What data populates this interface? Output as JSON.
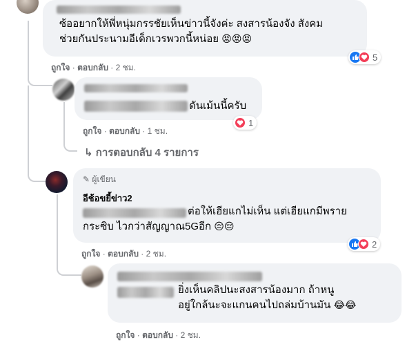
{
  "comments": [
    {
      "text_line1": "ซ้ออยากให้พี่หนุ่มกรรชัยเห็นข่าวนี้จังค่ะ สงสารน้องจัง สังคม",
      "text_line2": "ช่วยกันประนามอีเด็กเวรพวกนี้หน่อย",
      "emoji": "😡😡😡",
      "like_label": "ถูกใจ",
      "reply_label": "ตอบกลับ",
      "time": "2 ชม.",
      "reaction_count": "5"
    },
    {
      "text": "ดันเม้นนี้ครับ",
      "like_label": "ถูกใจ",
      "reply_label": "ตอบกลับ",
      "time": "1 ชม.",
      "reaction_count": "1",
      "replies_link": "การตอบกลับ 4 รายการ"
    },
    {
      "author_badge": "ผู้เขียน",
      "author_name": "อีช้อขยี้ข่าว2",
      "text_line1": "ต่อให้เฮียแกไม่เห็น แต่เฮียแกมีพราย",
      "text_line2": "กระซิบ ไวกว่าสัญญาณ5Gอีก",
      "emoji": "😔😔",
      "like_label": "ถูกใจ",
      "reply_label": "ตอบกลับ",
      "time": "2 ชม.",
      "reaction_count": "2"
    },
    {
      "text_line1": "ยิ่งเห็นคลิปนะสงสารน้องมาก ถ้าหนู",
      "text_line2": "อยู่ใกล้นะจะแกนคนไปถล่มบ้านมัน",
      "emoji": "😂😂",
      "like_label": "ถูกใจ",
      "reply_label": "ตอบกลับ",
      "time": "2 ชม."
    }
  ],
  "colors": {
    "bubble": "#f0f2f5",
    "meta": "#65676b",
    "like": "#1877f2",
    "love": "#f33e58"
  }
}
